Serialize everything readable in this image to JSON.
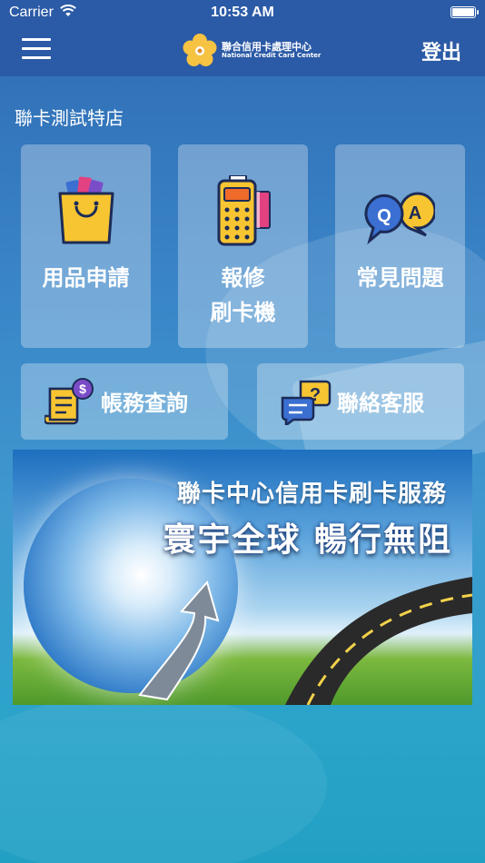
{
  "status_bar": {
    "carrier": "Carrier",
    "time": "10:53 AM"
  },
  "nav": {
    "logo_zh": "聯合信用卡處理中心",
    "logo_en": "National Credit Card Center",
    "logout_label": "登出"
  },
  "store_name": "聯卡測試特店",
  "tiles": [
    {
      "label": "用品申請",
      "icon": "shopping-bag-icon"
    },
    {
      "label_line1": "報修",
      "label_line2": "刷卡機",
      "icon": "card-terminal-icon"
    },
    {
      "label": "常見問題",
      "icon": "qa-bubbles-icon"
    },
    {
      "label": "帳務查詢",
      "icon": "bill-dollar-icon"
    },
    {
      "label": "聯絡客服",
      "icon": "chat-question-icon"
    }
  ],
  "banner": {
    "title1": "聯卡中心信用卡刷卡服務",
    "title2": "寰宇全球  暢行無阻"
  },
  "colors": {
    "nav_bg": "#2b5aa6",
    "logo_yellow": "#f6c342",
    "tile_bg": "rgba(255,255,255,0.30)"
  }
}
